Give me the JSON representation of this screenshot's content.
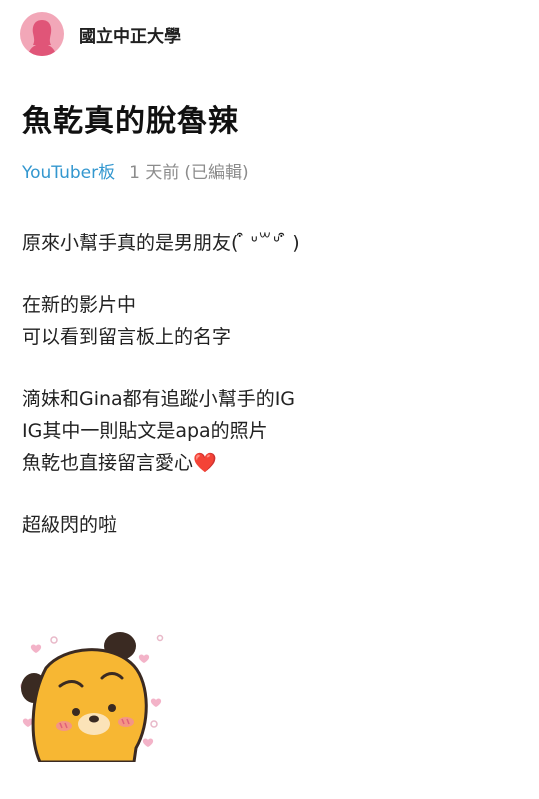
{
  "header": {
    "school_name": "國立中正大學",
    "avatar_icon": "female-avatar-icon",
    "avatar_color": "#f2a7b8"
  },
  "post": {
    "title": "魚乾真的脫魯辣",
    "board": "YouTuber板",
    "time": "1 天前",
    "edited": "(已編輯)",
    "body": {
      "line1": "原來小幫手真的是男朋友(  ͒ ᐡ꒳ᐡ ͒ )",
      "line2": "在新的影片中",
      "line3": "可以看到留言板上的名字",
      "line4": "滴妹和Gina都有追蹤小幫手的IG",
      "line5": "IG其中一則貼文是apa的照片",
      "line6": "魚乾也直接留言愛心❤️",
      "line7": "超級閃的啦"
    },
    "sticker_icon": "blushing-bear-sticker-icon",
    "colors": {
      "board_link": "#3397cf",
      "meta_gray": "#8c8c8c"
    }
  }
}
